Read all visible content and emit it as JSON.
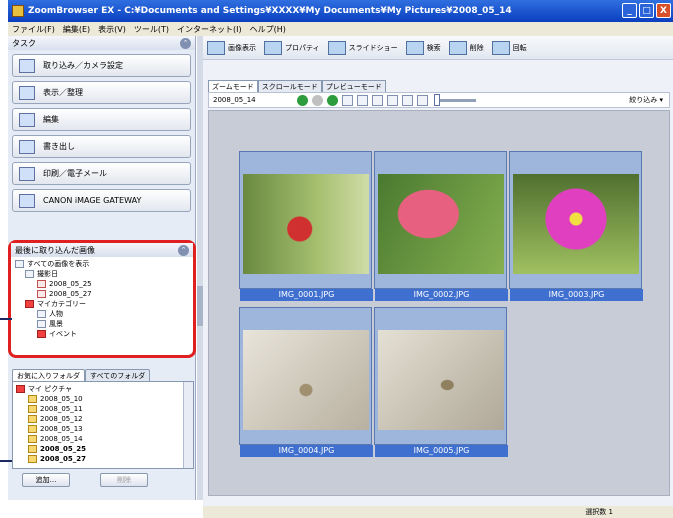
{
  "window": {
    "title": "ZoomBrowser EX  -  C:¥Documents and Settings¥XXXX¥My Documents¥My Pictures¥2008_05_14",
    "min": "_",
    "max": "□",
    "close": "X"
  },
  "menu": [
    "ファイル(F)",
    "編集(E)",
    "表示(V)",
    "ツール(T)",
    "インターネット(I)",
    "ヘルプ(H)"
  ],
  "tasks": {
    "header": "タスク",
    "items": [
      "取り込み／カメラ設定",
      "表示／整理",
      "編集",
      "書き出し",
      "印刷／電子メール",
      "CANON iMAGE GATEWAY"
    ]
  },
  "recent": {
    "header": "最後に取り込んだ画像",
    "tree": [
      "すべての画像を表示",
      "撮影日",
      "2008_05_25",
      "2008_05_27",
      "マイカテゴリー",
      "人物",
      "風景",
      "イベント"
    ]
  },
  "favorites": {
    "tabs": [
      "お気に入りフォルダ",
      "すべてのフォルダ"
    ],
    "root": "マイ ピクチャ",
    "folders": [
      "2008_05_10",
      "2008_05_11",
      "2008_05_12",
      "2008_05_13",
      "2008_05_14",
      "2008_05_25",
      "2008_05_27"
    ],
    "add_button": "追加...",
    "delete_button": "削除"
  },
  "toolbar": [
    "画像表示",
    "プロパティ",
    "スライドショー",
    "検索",
    "削除",
    "回転"
  ],
  "mode_tabs": [
    "ズームモード",
    "スクロールモード",
    "プレビューモード"
  ],
  "subbar": {
    "folder": "2008_05_14",
    "filter": "絞り込み ▾"
  },
  "thumbnails": [
    "IMG_0001.JPG",
    "IMG_0002.JPG",
    "IMG_0003.JPG",
    "IMG_0004.JPG",
    "IMG_0005.JPG"
  ],
  "status": "選択数 1"
}
